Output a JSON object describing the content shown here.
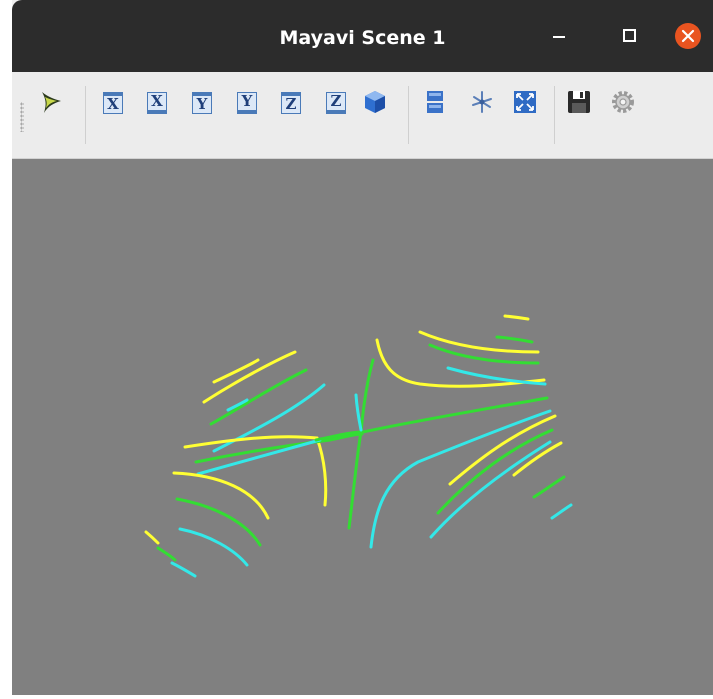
{
  "window": {
    "title": "Mayavi Scene 1",
    "controls": [
      "minimize-icon",
      "maximize-icon",
      "close-icon"
    ],
    "close_color": "#e95420"
  },
  "toolbar": {
    "groups": [
      [
        "mayavi-logo-icon"
      ],
      [
        "view-x-plus-icon",
        "view-x-minus-icon",
        "view-y-plus-icon",
        "view-y-minus-icon",
        "view-z-plus-icon",
        "view-z-minus-icon",
        "isometric-cube-icon"
      ],
      [
        "parallel-projection-icon",
        "axes-toggle-icon",
        "fullscreen-icon"
      ],
      [
        "save-icon",
        "settings-icon"
      ]
    ],
    "axis_labels": [
      "X",
      "X",
      "Y",
      "Y",
      "Z",
      "Z"
    ]
  },
  "scene": {
    "background": "#808080",
    "line_colors": {
      "yellow": "#ffff33",
      "green": "#33dd33",
      "cyan": "#33e8e8"
    },
    "content": "streamlines"
  }
}
